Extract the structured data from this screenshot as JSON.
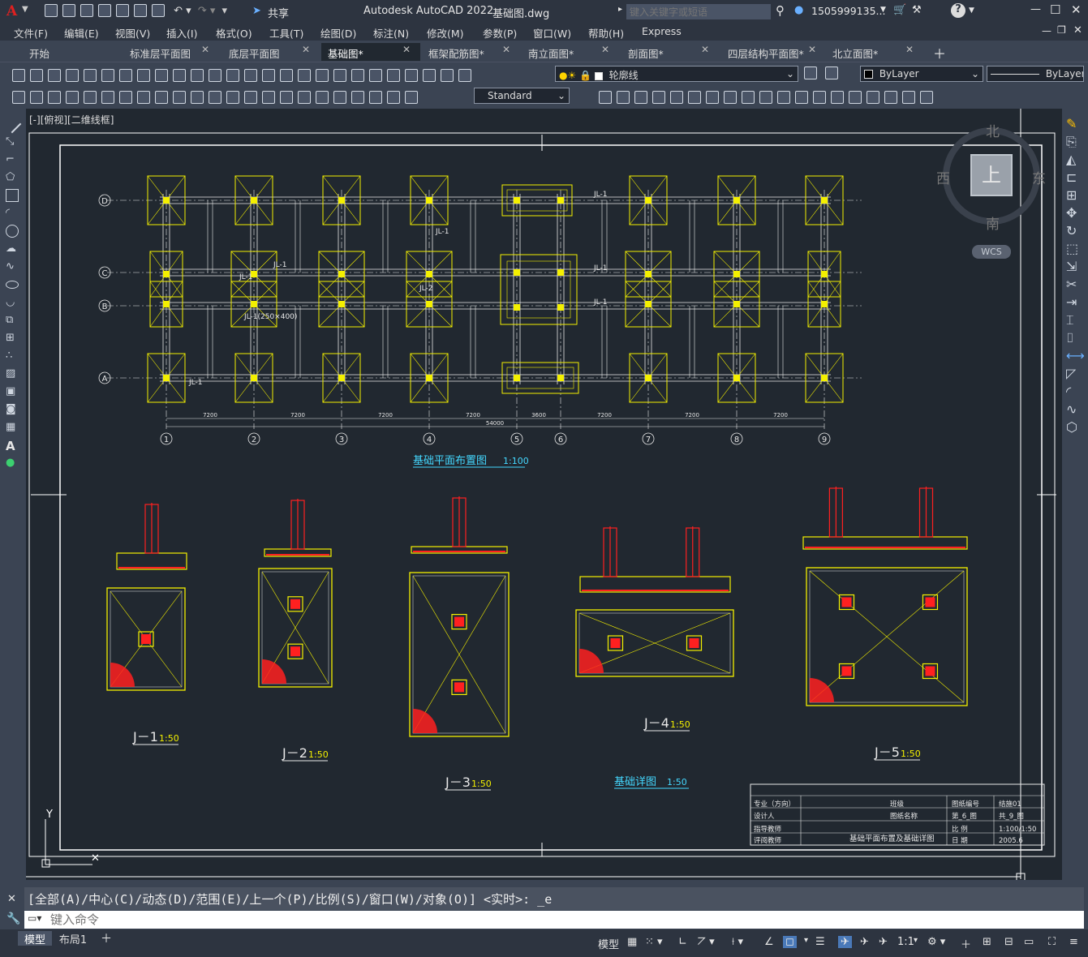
{
  "title": {
    "app": "Autodesk AutoCAD 2022",
    "file": "基础图.dwg",
    "share": "共享",
    "search_placeholder": "键入关键字或短语",
    "user": "1505999135...",
    "help": "?"
  },
  "menu": [
    "文件(F)",
    "编辑(E)",
    "视图(V)",
    "插入(I)",
    "格式(O)",
    "工具(T)",
    "绘图(D)",
    "标注(N)",
    "修改(M)",
    "参数(P)",
    "窗口(W)",
    "帮助(H)",
    "Express"
  ],
  "tabs": [
    {
      "label": "开始",
      "active": false
    },
    {
      "label": "标准层平面图",
      "active": false
    },
    {
      "label": "底层平面图",
      "active": false
    },
    {
      "label": "基础图*",
      "active": true
    },
    {
      "label": "框架配筋图*",
      "active": false
    },
    {
      "label": "南立面图*",
      "active": false
    },
    {
      "label": "剖面图*",
      "active": false
    },
    {
      "label": "四层结构平面图*",
      "active": false
    },
    {
      "label": "北立面图*",
      "active": false
    }
  ],
  "toolbar": {
    "layer": "轮廓线",
    "color": "ByLayer",
    "linetype": "ByLayer",
    "text_style": "Standard"
  },
  "viewport_label": "[-][俯视][二维线框]",
  "viewcube": {
    "n": "北",
    "s": "南",
    "e": "东",
    "w": "西",
    "top": "上",
    "wcs": "WCS"
  },
  "drawing": {
    "plan_title": "基础平面布置图",
    "plan_scale": "1:100",
    "detail_title": "基础详图",
    "detail_scale": "1:50",
    "axes_x": [
      "1",
      "2",
      "3",
      "4",
      "5",
      "6",
      "7",
      "8",
      "9"
    ],
    "axes_y": [
      "D",
      "C",
      "B",
      "A"
    ],
    "spans": [
      "7200",
      "7200",
      "7200",
      "7200",
      "3600",
      "7200",
      "7200",
      "7200"
    ],
    "total": "54000",
    "beams": [
      "JL-1",
      "JL-2",
      "JL-1(250×400)",
      "JL-1",
      "JL-1"
    ],
    "details": [
      {
        "name": "J－1",
        "scale": "1:50"
      },
      {
        "name": "J－2",
        "scale": "1:50"
      },
      {
        "name": "J－3",
        "scale": "1:50"
      },
      {
        "name": "J－4",
        "scale": "1:50"
      },
      {
        "name": "J－5",
        "scale": "1:50"
      }
    ],
    "titleblock": {
      "row1": [
        "专业（方向）",
        "班级",
        "图纸编号",
        "结施01"
      ],
      "row2": [
        "设计人",
        "图纸名称",
        "第_6_图",
        "共_9_图"
      ],
      "row3": [
        "指导教师",
        "比 例",
        "1:100/1:50"
      ],
      "row4": [
        "评阅教师",
        "日 期",
        "2005.6"
      ],
      "drawing_name": "基础平面布置及基础详图"
    }
  },
  "command": {
    "history": "[全部(A)/中心(C)/动态(D)/范围(E)/上一个(P)/比例(S)/窗口(W)/对象(O)] <实时>: _e",
    "placeholder": "键入命令"
  },
  "status": {
    "tabs": [
      "模型",
      "布局1"
    ],
    "model": "模型",
    "scale": "1:1"
  }
}
